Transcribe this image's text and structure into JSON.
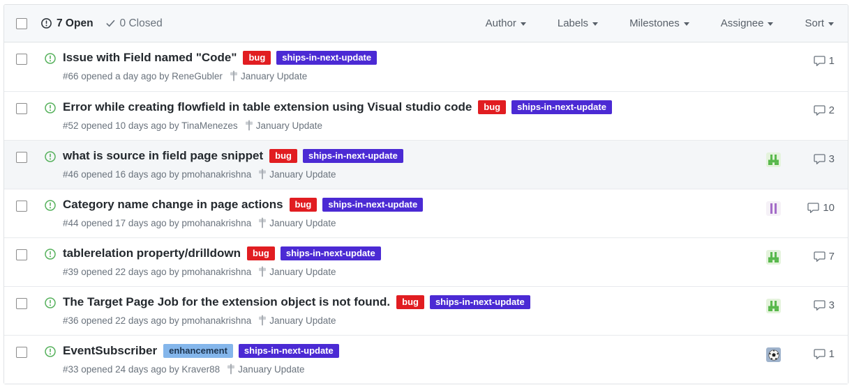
{
  "theme": {
    "open_icon_green": "#56b15c",
    "header_icon_dark": "#30363c",
    "icon_gray": "#6a737d",
    "milestone_gray": "#a3a8ae"
  },
  "header": {
    "open_label": "7 Open",
    "closed_label": "0 Closed",
    "filters": [
      {
        "label": "Author"
      },
      {
        "label": "Labels"
      },
      {
        "label": "Milestones"
      },
      {
        "label": "Assignee"
      },
      {
        "label": "Sort"
      }
    ]
  },
  "issues": [
    {
      "title": "Issue with Field named \"Code\"",
      "labels": [
        {
          "text": "bug",
          "bg": "#e11d21",
          "color": "#ffffff"
        },
        {
          "text": "ships-in-next-update",
          "bg": "#4b2ad4",
          "color": "#ffffff"
        }
      ],
      "meta": "#66 opened a day ago by ReneGubler",
      "milestone": "January Update",
      "comments": "1",
      "avatar": null
    },
    {
      "title": "Error while creating flowfield in table extension using Visual studio code",
      "labels": [
        {
          "text": "bug",
          "bg": "#e11d21",
          "color": "#ffffff"
        },
        {
          "text": "ships-in-next-update",
          "bg": "#4b2ad4",
          "color": "#ffffff"
        }
      ],
      "meta": "#52 opened 10 days ago by TinaMenezes",
      "milestone": "January Update",
      "comments": "2",
      "avatar": null
    },
    {
      "title": "what is source in field page snippet",
      "labels": [
        {
          "text": "bug",
          "bg": "#e11d21",
          "color": "#ffffff"
        },
        {
          "text": "ships-in-next-update",
          "bg": "#4b2ad4",
          "color": "#ffffff"
        }
      ],
      "meta": "#46 opened 16 days ago by pmohanakrishna",
      "milestone": "January Update",
      "comments": "3",
      "avatar": {
        "kind": "identicon",
        "name": "green-identicon-avatar",
        "bg": "#e4f3dc",
        "fg": "#58b84c",
        "pattern": [
          ".X.X.",
          ".X.X.",
          "XXXXX",
          "XX.XX"
        ]
      }
    },
    {
      "title": "Category name change in page actions",
      "labels": [
        {
          "text": "bug",
          "bg": "#e11d21",
          "color": "#ffffff"
        },
        {
          "text": "ships-in-next-update",
          "bg": "#4b2ad4",
          "color": "#ffffff"
        }
      ],
      "meta": "#44 opened 17 days ago by pmohanakrishna",
      "milestone": "January Update",
      "comments": "10",
      "avatar": {
        "kind": "identicon",
        "name": "purple-identicon-avatar",
        "bg": "#f5f1f7",
        "fg": "#a46cc8",
        "pattern": [
          ".X.X.",
          ".X.X.",
          ".X.X.",
          ".X.X.",
          ".X.X."
        ]
      }
    },
    {
      "title": "tablerelation property/drilldown",
      "labels": [
        {
          "text": "bug",
          "bg": "#e11d21",
          "color": "#ffffff"
        },
        {
          "text": "ships-in-next-update",
          "bg": "#4b2ad4",
          "color": "#ffffff"
        }
      ],
      "meta": "#39 opened 22 days ago by pmohanakrishna",
      "milestone": "January Update",
      "comments": "7",
      "avatar": {
        "kind": "identicon",
        "name": "green-identicon-avatar",
        "bg": "#e4f3dc",
        "fg": "#58b84c",
        "pattern": [
          ".X.X.",
          ".X.X.",
          "XXXXX",
          "XX.XX"
        ]
      }
    },
    {
      "title": "The Target Page Job for the extension object is not found.",
      "labels": [
        {
          "text": "bug",
          "bg": "#e11d21",
          "color": "#ffffff"
        },
        {
          "text": "ships-in-next-update",
          "bg": "#4b2ad4",
          "color": "#ffffff"
        }
      ],
      "meta": "#36 opened 22 days ago by pmohanakrishna",
      "milestone": "January Update",
      "comments": "3",
      "avatar": {
        "kind": "identicon",
        "name": "green-identicon-avatar",
        "bg": "#e4f3dc",
        "fg": "#58b84c",
        "pattern": [
          ".X.X.",
          ".X.X.",
          "XXXXX",
          "XX.XX"
        ]
      }
    },
    {
      "title": "EventSubscriber",
      "labels": [
        {
          "text": "enhancement",
          "bg": "#84b6eb",
          "color": "#1c3450"
        },
        {
          "text": "ships-in-next-update",
          "bg": "#4b2ad4",
          "color": "#ffffff"
        }
      ],
      "meta": "#33 opened 24 days ago by Kraver88",
      "milestone": "January Update",
      "comments": "1",
      "avatar": {
        "kind": "soccer",
        "name": "soccer-ball-photo-avatar",
        "bg": "#9fb3cc"
      }
    }
  ]
}
